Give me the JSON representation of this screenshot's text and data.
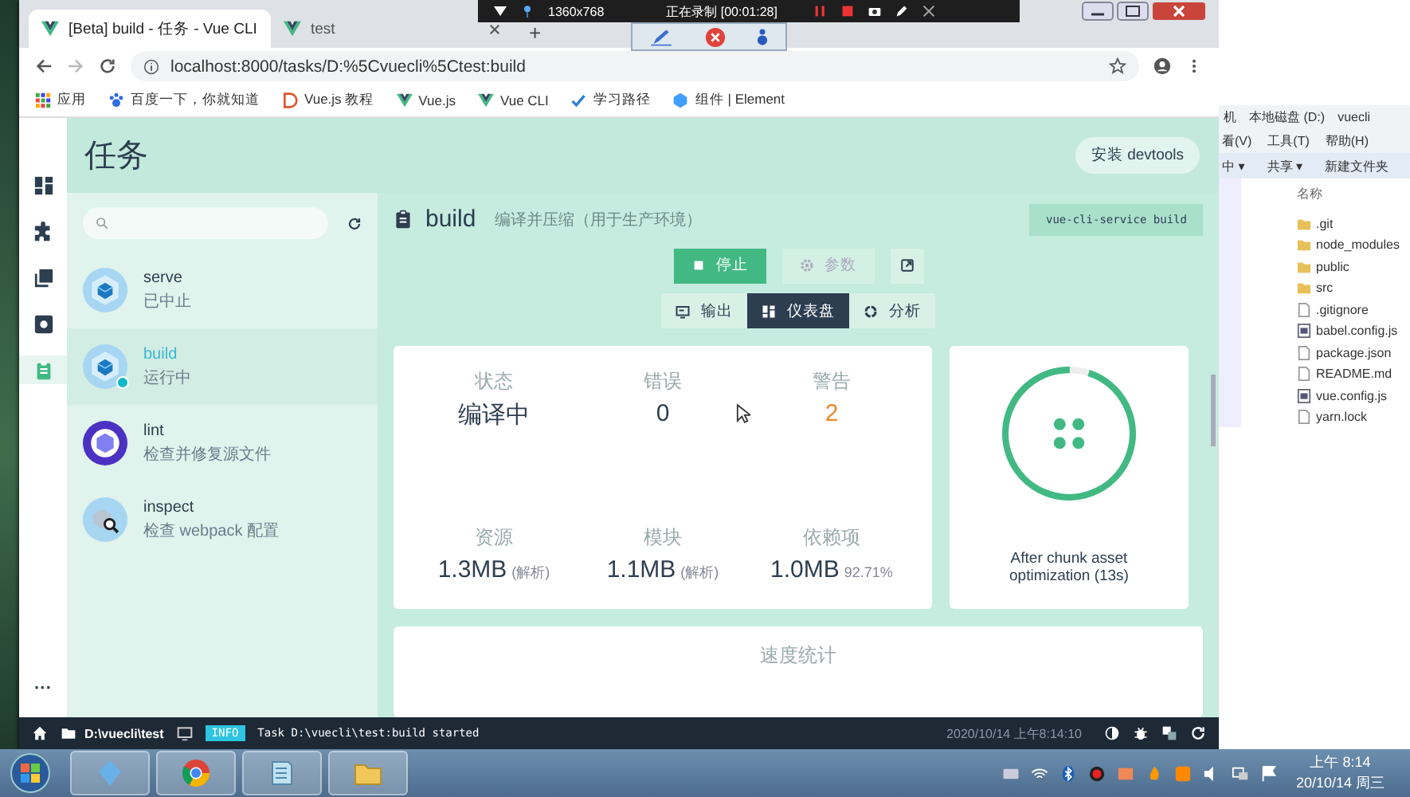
{
  "recorder": {
    "resolution": "1360x768",
    "status": "正在录制 [00:01:28]"
  },
  "browser": {
    "tabs": [
      {
        "title": "[Beta] build - 任务 - Vue CLI",
        "selected": true
      },
      {
        "title": "test",
        "selected": false
      }
    ],
    "new_tab": "+",
    "address": "localhost:8000/tasks/D:%5Cvuecli%5Ctest:build",
    "bookmarks": [
      {
        "label": "应用",
        "kind": "apps"
      },
      {
        "label": "百度一下，你就知道",
        "kind": "paw"
      },
      {
        "label": "Vue.js 教程",
        "kind": "d"
      },
      {
        "label": "Vue.js",
        "kind": "vue"
      },
      {
        "label": "Vue CLI",
        "kind": "vue"
      },
      {
        "label": "学习路径",
        "kind": "check"
      },
      {
        "label": "组件 | Element",
        "kind": "element"
      }
    ]
  },
  "app": {
    "rail": [
      {
        "kind": "dashboard",
        "selected": false
      },
      {
        "kind": "plugins",
        "selected": false
      },
      {
        "kind": "dependencies",
        "selected": false
      },
      {
        "kind": "config",
        "selected": false
      },
      {
        "kind": "tasks",
        "selected": true
      }
    ],
    "rail_more": "···",
    "title": "任务",
    "devtools_button": "安装 devtools",
    "tasks": [
      {
        "name": "serve",
        "description": "已中止",
        "kind": "webpack",
        "selected": false,
        "running": false
      },
      {
        "name": "build",
        "description": "运行中",
        "kind": "webpack",
        "selected": true,
        "running": true
      },
      {
        "name": "lint",
        "description": "检查并修复源文件",
        "kind": "eslint",
        "selected": false,
        "running": false
      },
      {
        "name": "inspect",
        "description": "检查 webpack 配置",
        "kind": "inspect",
        "selected": false,
        "running": false
      }
    ],
    "task": {
      "name": "build",
      "description": "编译并压缩（用于生产环境）",
      "command": "vue-cli-service build",
      "buttons": [
        {
          "label": "停止",
          "kind": "stop",
          "disabled": false
        },
        {
          "label": "参数",
          "kind": "params",
          "disabled": true
        }
      ],
      "views": [
        {
          "label": "输出",
          "kind": "output",
          "selected": false
        },
        {
          "label": "仪表盘",
          "kind": "dashboard",
          "selected": true
        },
        {
          "label": "分析",
          "kind": "analyze",
          "selected": false
        }
      ],
      "stats": [
        {
          "label": "状态",
          "value": "编译中",
          "warning": false
        },
        {
          "label": "错误",
          "value": "0",
          "warning": false
        },
        {
          "label": "警告",
          "value": "2",
          "warning": true
        },
        {
          "label": "资源",
          "value": "1.3MB",
          "note": "(解析)",
          "warning": false
        },
        {
          "label": "模块",
          "value": "1.1MB",
          "note": "(解析)",
          "warning": false
        },
        {
          "label": "依赖项",
          "value": "1.0MB",
          "note": "92.71%",
          "warning": false
        }
      ],
      "progress": {
        "level": 0.95,
        "caption": "After chunk asset optimization (13s)"
      },
      "speed_title": "速度统计"
    },
    "status_bar": {
      "folder": "D:\\vuecli\\test",
      "badge": "INFO",
      "message": "Task D:\\vuecli\\test:build started",
      "time": "2020/10/14 上午8:14:10"
    }
  },
  "explorer": {
    "breadcrumb": [
      "机",
      "本地磁盘 (D:)",
      "vuecli"
    ],
    "menu": [
      "看(V)",
      "工具(T)",
      "帮助(H)"
    ],
    "toolbar": [
      "中 ▾",
      "共享 ▾",
      "新建文件夹"
    ],
    "column": "名称",
    "files": [
      {
        "name": ".git",
        "kind": "folder"
      },
      {
        "name": "node_modules",
        "kind": "folder"
      },
      {
        "name": "public",
        "kind": "folder"
      },
      {
        "name": "src",
        "kind": "folder"
      },
      {
        "name": ".gitignore",
        "kind": "file"
      },
      {
        "name": "babel.config.js",
        "kind": "script"
      },
      {
        "name": "package.json",
        "kind": "file"
      },
      {
        "name": "README.md",
        "kind": "file"
      },
      {
        "name": "vue.config.js",
        "kind": "script"
      },
      {
        "name": "yarn.lock",
        "kind": "file"
      }
    ]
  },
  "taskbar": {
    "apps": [
      {
        "kind": "gem"
      },
      {
        "kind": "chrome"
      },
      {
        "kind": "notepad"
      },
      {
        "kind": "folder"
      }
    ],
    "clock_time": "上午 8:14",
    "clock_date": "20/10/14 周三"
  }
}
